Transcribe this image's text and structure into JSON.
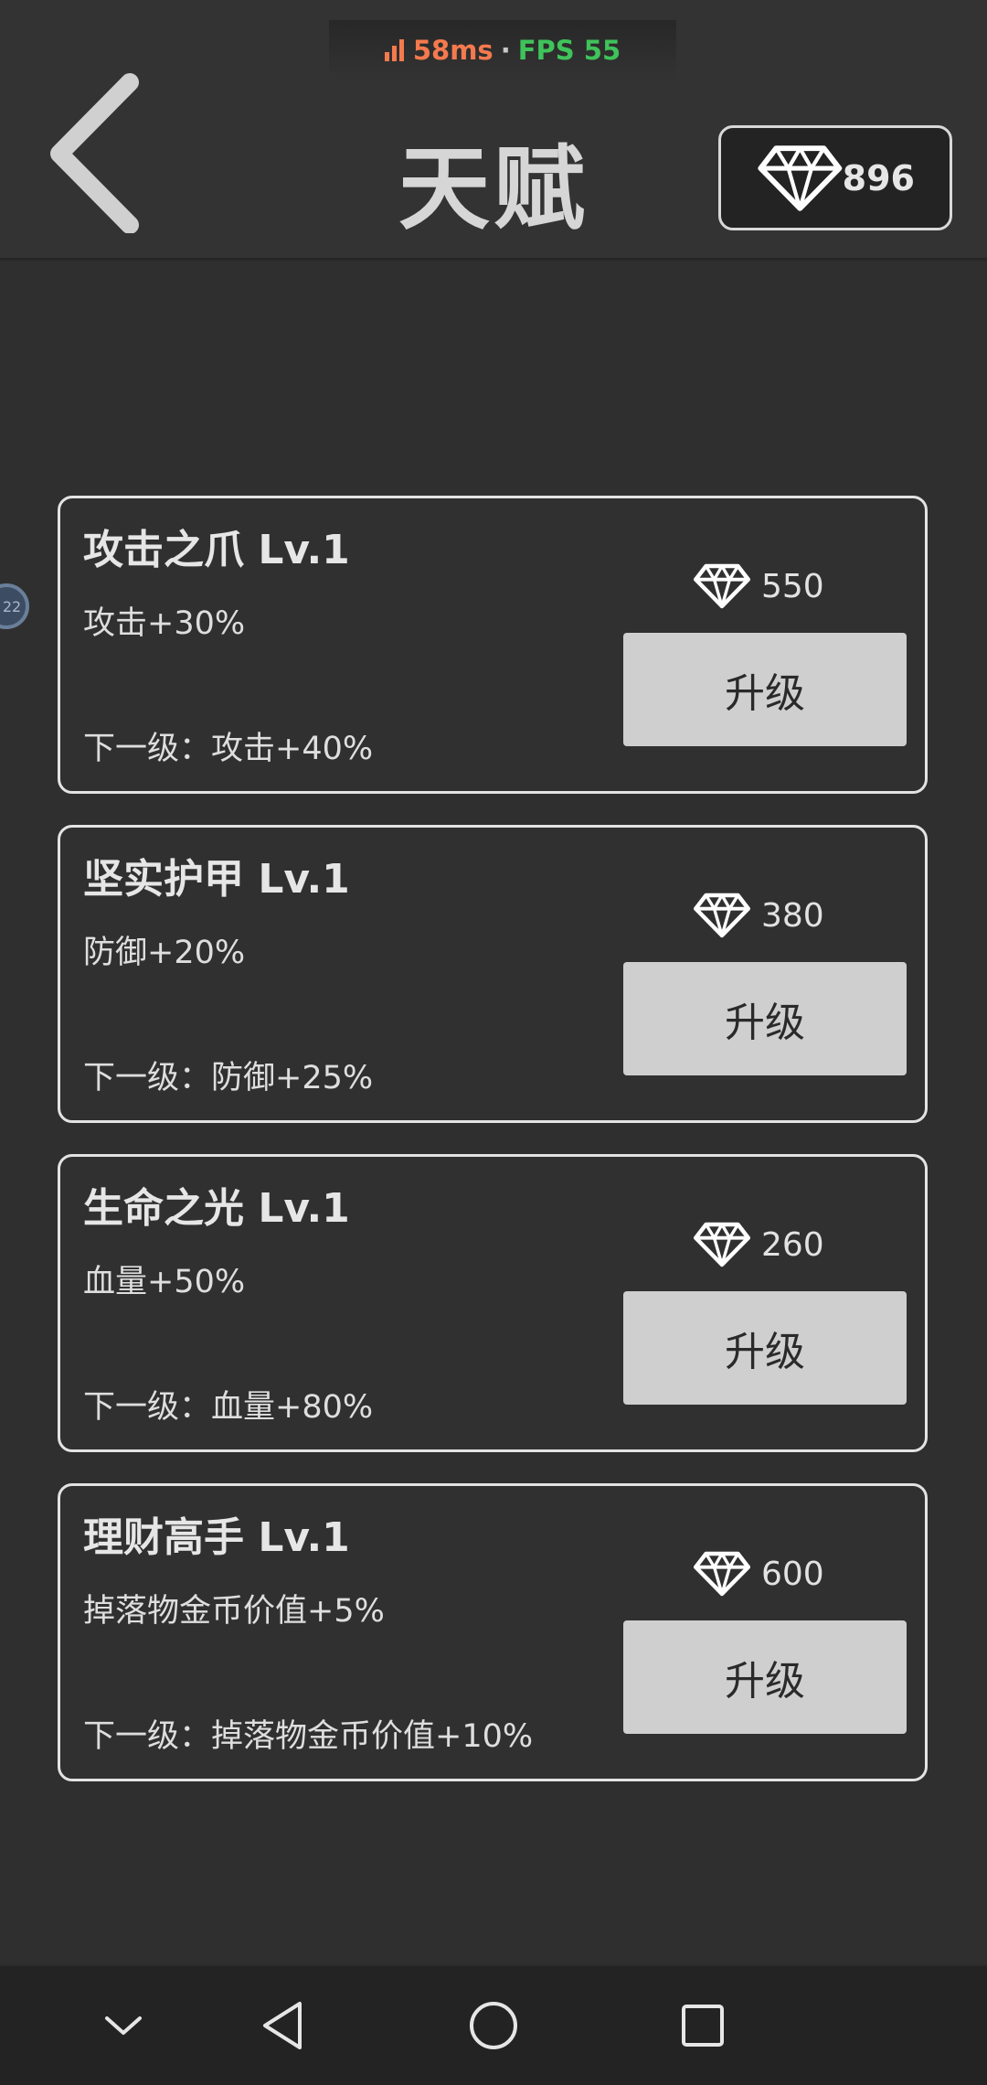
{
  "status": {
    "latency": "58ms",
    "separator": "·",
    "fps": "FPS 55"
  },
  "header": {
    "title": "天赋",
    "gems": "896"
  },
  "float_ball": {
    "label": "22"
  },
  "talents": [
    {
      "name": "攻击之爪 Lv.1",
      "effect": "攻击+30%",
      "cost": "550",
      "button": "升级",
      "next": "下一级：攻击+40%"
    },
    {
      "name": "坚实护甲 Lv.1",
      "effect": "防御+20%",
      "cost": "380",
      "button": "升级",
      "next": "下一级：防御+25%"
    },
    {
      "name": "生命之光 Lv.1",
      "effect": "血量+50%",
      "cost": "260",
      "button": "升级",
      "next": "下一级：血量+80%"
    },
    {
      "name": "理财高手 Lv.1",
      "effect": "掉落物金币价值+5%",
      "cost": "600",
      "button": "升级",
      "next": "下一级：掉落物金币价值+10%"
    }
  ],
  "colors": {
    "latency": "#f47a4e",
    "fps": "#3fc35a",
    "button": "#cfcfcf"
  },
  "icons": [
    "signal-icon",
    "back-arrow-icon",
    "diamond-icon",
    "nav-collapse-icon",
    "nav-back-icon",
    "nav-home-icon",
    "nav-recents-icon"
  ]
}
